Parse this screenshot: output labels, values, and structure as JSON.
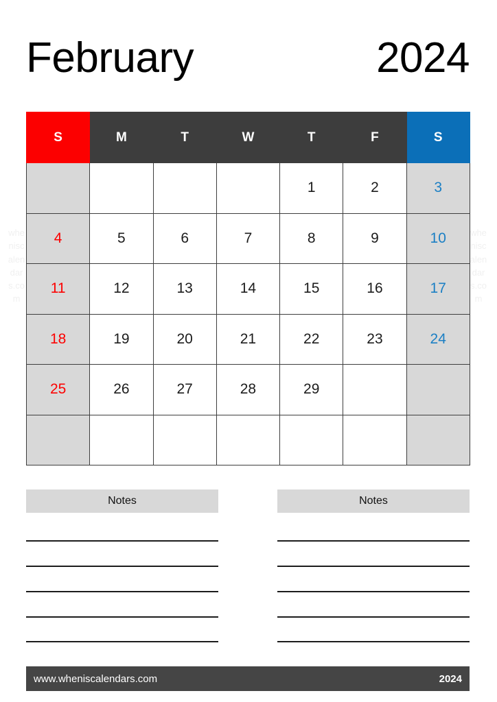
{
  "watermark": {
    "text": "wheniscalendars.com"
  },
  "title": {
    "month": "February",
    "year": "2024"
  },
  "calendar": {
    "weekday_headers": [
      {
        "label": "S",
        "kind": "sunday"
      },
      {
        "label": "M",
        "kind": "weekday"
      },
      {
        "label": "T",
        "kind": "weekday"
      },
      {
        "label": "W",
        "kind": "weekday"
      },
      {
        "label": "T",
        "kind": "weekday"
      },
      {
        "label": "F",
        "kind": "weekday"
      },
      {
        "label": "S",
        "kind": "saturday"
      }
    ],
    "weeks": [
      [
        "",
        "",
        "",
        "",
        "1",
        "2",
        "3"
      ],
      [
        "4",
        "5",
        "6",
        "7",
        "8",
        "9",
        "10"
      ],
      [
        "11",
        "12",
        "13",
        "14",
        "15",
        "16",
        "17"
      ],
      [
        "18",
        "19",
        "20",
        "21",
        "22",
        "23",
        "24"
      ],
      [
        "25",
        "26",
        "27",
        "28",
        "29",
        "",
        ""
      ],
      [
        "",
        "",
        "",
        "",
        "",
        "",
        ""
      ]
    ],
    "colors": {
      "sunday_header_bg": "#fc0000",
      "weekday_header_bg": "#3d3d3d",
      "saturday_header_bg": "#0b6fb8",
      "weekend_cell_bg": "#d8d8d8",
      "sunday_text": "#fc0000",
      "saturday_text": "#1b7fc4",
      "weekday_text": "#1c1c1c",
      "grid_line": "#3d3d3d"
    }
  },
  "notes": {
    "columns": [
      {
        "label": "Notes",
        "line_count": 5
      },
      {
        "label": "Notes",
        "line_count": 5
      }
    ]
  },
  "footer": {
    "url": "www.wheniscalendars.com",
    "year": "2024",
    "bg": "#454545"
  }
}
